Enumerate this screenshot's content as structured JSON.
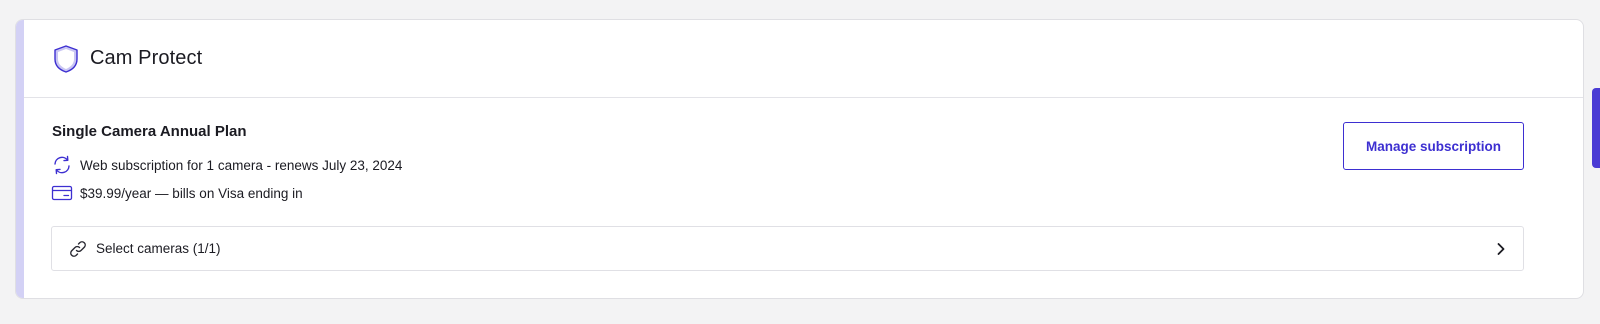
{
  "card": {
    "title": "Cam Protect",
    "icon": "shield-icon"
  },
  "plan": {
    "name": "Single Camera Annual Plan",
    "renewal_text": "Web subscription for 1 camera - renews July 23, 2024",
    "renewal_icon": "refresh-icon",
    "billing_text": "$39.99/year — bills on Visa ending in",
    "billing_icon": "credit-card-icon"
  },
  "actions": {
    "manage_label": "Manage subscription"
  },
  "cameras": {
    "label": "Select cameras (1/1)",
    "icon": "link-icon",
    "chevron_icon": "chevron-right-icon"
  },
  "colors": {
    "accent": "#3d2fd1",
    "card_accent_bar": "#d3d1f5",
    "background": "#f3f3f4"
  }
}
